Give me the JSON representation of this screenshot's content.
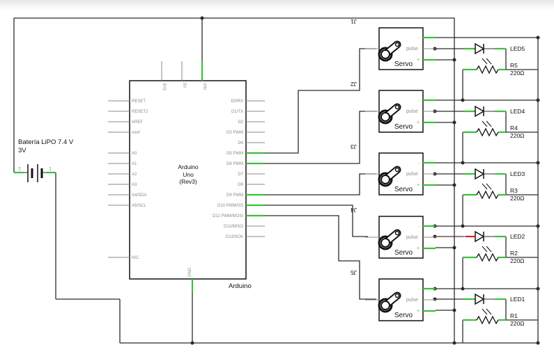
{
  "battery": {
    "name": "Batería LiPO 7.4 V",
    "voltage": "3V",
    "pin_minus": "2",
    "pin_plus": "1"
  },
  "arduino": {
    "name": "Arduino",
    "title": "Arduino",
    "model": "Uno",
    "rev": "(Rev3)",
    "top_pins": [
      "3V3",
      "5V",
      "VIN"
    ],
    "left_pins": [
      "RESET",
      "RESET2",
      "AREF",
      "ioref",
      "A0",
      "A1",
      "A2",
      "A3",
      "A4/SDA",
      "A5/SCL",
      "N/C"
    ],
    "right_pins": [
      "D0/RX",
      "D1/TX",
      "D2",
      "D3 PWM",
      "D4",
      "D5 PWM",
      "D6 PWM",
      "D7",
      "D8",
      "D9 PWM",
      "D10 PWM/SS",
      "D11 PWM/MOSI",
      "D12/MISO",
      "D13/SCK"
    ],
    "bottom_pin": "GND"
  },
  "servos": [
    {
      "ref": "J1",
      "label": "Servo",
      "pulse": "pulse",
      "minus": "-",
      "plus": "+"
    },
    {
      "ref": "J2",
      "label": "Servo",
      "pulse": "pulse",
      "minus": "-",
      "plus": "+"
    },
    {
      "ref": "J3",
      "label": "Servo",
      "pulse": "pulse",
      "minus": "-",
      "plus": "+"
    },
    {
      "ref": "J4",
      "label": "Servo",
      "pulse": "pulse",
      "minus": "-",
      "plus": "+"
    },
    {
      "ref": "J5",
      "label": "Servo",
      "pulse": "pulse",
      "minus": "-",
      "plus": "+"
    }
  ],
  "leds": [
    {
      "name": "LED5",
      "resistor": "R5",
      "value": "220Ω"
    },
    {
      "name": "LED4",
      "resistor": "R4",
      "value": "220Ω"
    },
    {
      "name": "LED3",
      "resistor": "R3",
      "value": "220Ω"
    },
    {
      "name": "LED2",
      "resistor": "R2",
      "value": "220Ω"
    },
    {
      "name": "LED1",
      "resistor": "R1",
      "value": "220Ω"
    }
  ],
  "colors": {
    "wire": "#2b2b2b",
    "connected_pin": "#38c238",
    "unrouted": "#d22222",
    "pin_gray": "#8a8a8a"
  }
}
